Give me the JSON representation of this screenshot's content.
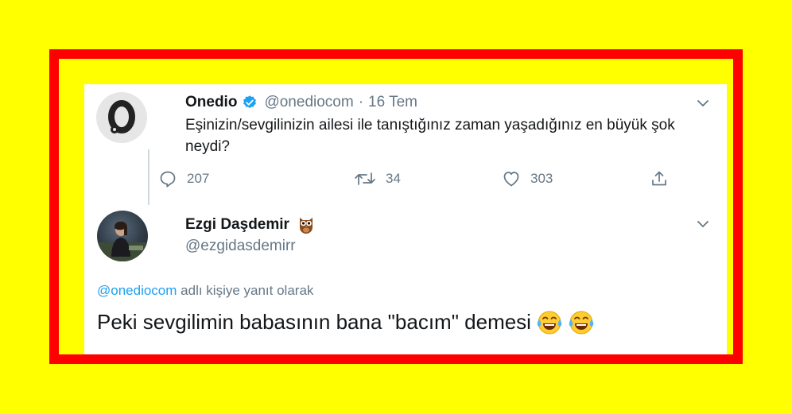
{
  "colors": {
    "background": "#ffff00",
    "frame": "#ff0000",
    "card": "#ffffff",
    "text_primary": "#14171a",
    "text_secondary": "#657786",
    "link": "#1da1f2",
    "verified": "#1da1f2"
  },
  "tweet1": {
    "avatar_icon": "onedio-logo-icon",
    "name": "Onedio",
    "verified_icon": "verified-badge-icon",
    "handle": "@onediocom",
    "separator": "·",
    "date": "16 Tem",
    "text": "Eşinizin/sevgilinizin ailesi ile tanıştığınız zaman yaşadığınız en büyük şok neydi?",
    "replies": "207",
    "retweets": "34",
    "likes": "303"
  },
  "tweet2": {
    "name": "Ezgi Daşdemir",
    "name_emoji_icon": "owl-icon",
    "handle": "@ezgidasdemirr",
    "reply_to_handle": "@onediocom",
    "reply_to_suffix": " adlı kişiye yanıt olarak",
    "text": "Peki sevgilimin babasının bana \"bacım\" demesi",
    "text_emojis": [
      "face-with-tears-of-joy-icon",
      "face-with-tears-of-joy-icon"
    ]
  }
}
